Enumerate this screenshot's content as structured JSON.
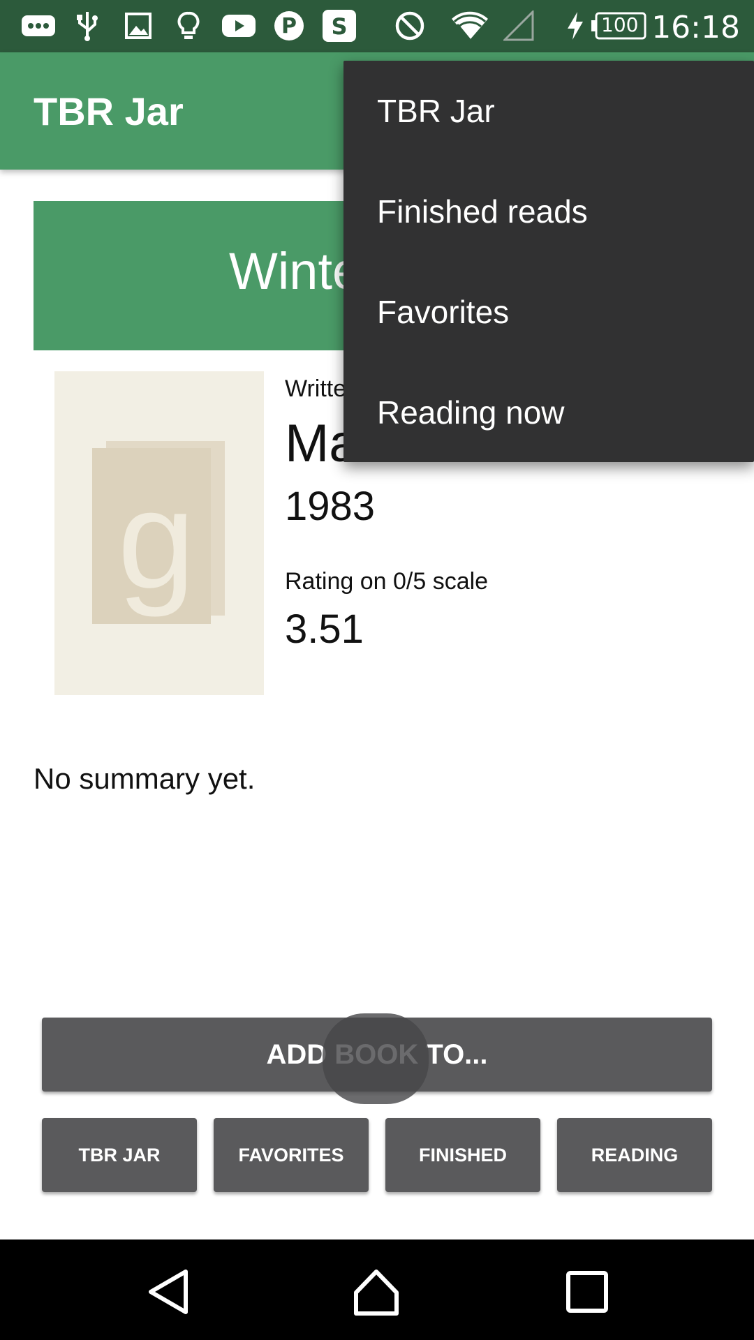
{
  "status_bar": {
    "icons": [
      "more-icon",
      "usb-icon",
      "gallery-icon",
      "lightbulb-icon",
      "youtube-icon",
      "pinterest-icon",
      "s-app-icon",
      "do-not-disturb-icon",
      "wifi-icon",
      "signal-icon",
      "charging-icon"
    ],
    "battery": "100",
    "time": "16:18"
  },
  "app_bar": {
    "title": "TBR Jar"
  },
  "book": {
    "title_visible": "Winte",
    "written_by_label": "Writte",
    "author_visible": "Ma",
    "year": "1983",
    "rating_label": "Rating on 0/5 scale",
    "rating": "3.51",
    "summary": "No summary yet."
  },
  "buttons": {
    "add": "ADD BOOK TO...",
    "tbr_jar": "TBR JAR",
    "favorites": "FAVORITES",
    "finished": "FINISHED",
    "reading": "READING"
  },
  "menu": {
    "items": [
      "TBR Jar",
      "Finished reads",
      "Favorites",
      "Reading now"
    ]
  },
  "colors": {
    "status_bar": "#2c5a3b",
    "app_bar": "#4a9a67",
    "button": "#5a5a5c",
    "menu": "#313132"
  },
  "nav_bar": {
    "icons": [
      "back-icon",
      "home-icon",
      "recents-icon"
    ]
  }
}
